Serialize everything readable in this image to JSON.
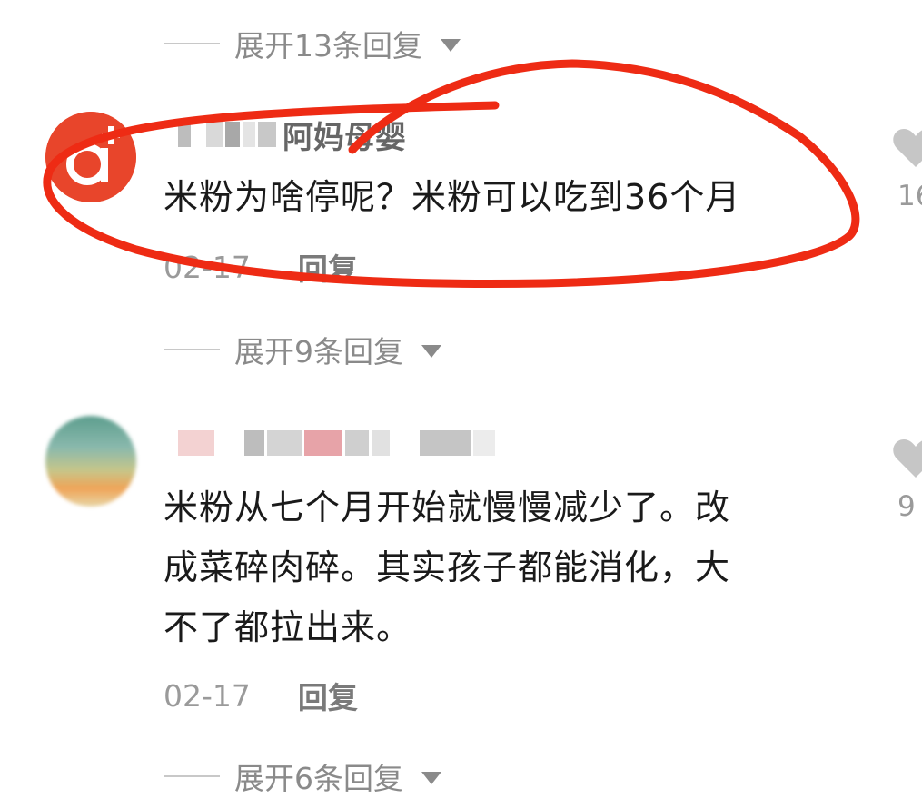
{
  "expand_replies": [
    {
      "text": "展开13条回复"
    },
    {
      "text": "展开9条回复"
    },
    {
      "text": "展开6条回复"
    }
  ],
  "comments": [
    {
      "username_visible": "阿妈母婴",
      "avatar_letter": "a",
      "text": "米粉为啥停呢？米粉可以吃到36个月",
      "date": "02-17",
      "reply_label": "回复",
      "likes": "16"
    },
    {
      "lines": [
        "米粉从七个月开始就慢慢减少了。改",
        "成菜碎肉碎。其实孩子都能消化，大",
        "不了都拉出来。"
      ],
      "date": "02-17",
      "reply_label": "回复",
      "likes": "9"
    }
  ],
  "icons": {
    "like": "heart-icon",
    "caret": "caret-down-icon",
    "avatar_plus": "plus-icon"
  },
  "colors": {
    "annotation_red": "#ee2b14",
    "avatar_orange": "#e8452b"
  }
}
